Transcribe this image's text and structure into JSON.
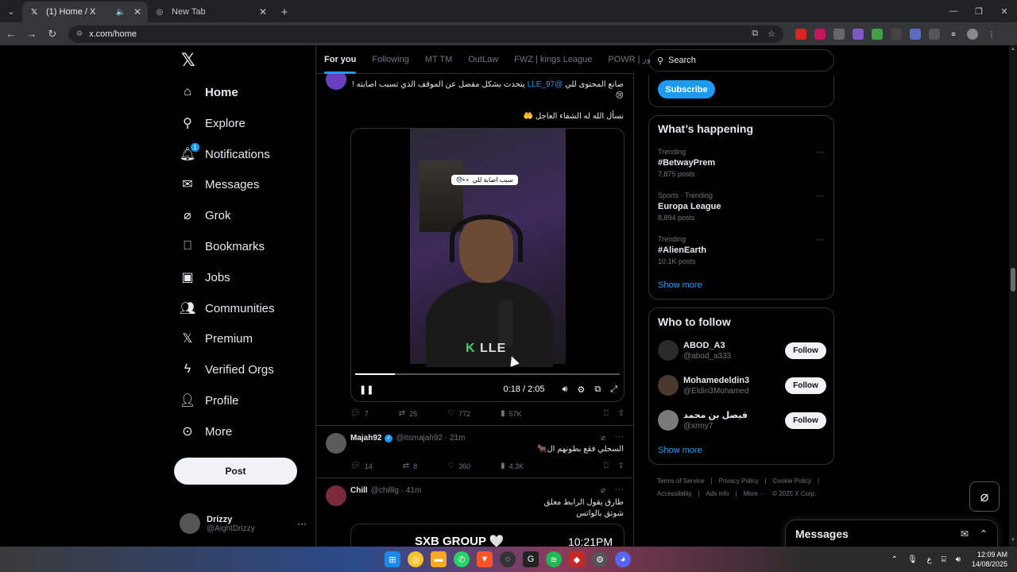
{
  "browser": {
    "tabs": [
      {
        "title": "(1) Home / X",
        "active": true
      },
      {
        "title": "New Tab",
        "active": false
      }
    ],
    "url": "x.com/home"
  },
  "nav": {
    "items": [
      {
        "label": "Home",
        "icon": "home-icon"
      },
      {
        "label": "Explore",
        "icon": "search-icon"
      },
      {
        "label": "Notifications",
        "icon": "bell-icon",
        "badge": "1"
      },
      {
        "label": "Messages",
        "icon": "envelope-icon"
      },
      {
        "label": "Grok",
        "icon": "grok-icon"
      },
      {
        "label": "Bookmarks",
        "icon": "bookmark-icon"
      },
      {
        "label": "Jobs",
        "icon": "briefcase-icon"
      },
      {
        "label": "Communities",
        "icon": "people-icon"
      },
      {
        "label": "Premium",
        "icon": "x-icon"
      },
      {
        "label": "Verified Orgs",
        "icon": "lightning-icon"
      },
      {
        "label": "Profile",
        "icon": "person-icon"
      },
      {
        "label": "More",
        "icon": "more-circle-icon"
      }
    ],
    "post_label": "Post",
    "account": {
      "name": "Drizzy",
      "handle": "@AightDrizzy"
    }
  },
  "feed": {
    "tabs": [
      "For you",
      "Following",
      "MT TM",
      "OutLaw",
      "FWZ | kings League",
      "POWR | ور"
    ],
    "tweet1": {
      "line1_pre": "صانع المحتوى للي",
      "mention": "@LLE_97",
      "line1_post": "يتحدث بشكل مفصل عن الموقف الذي تسبب اصابته !",
      "line2": "😢",
      "line3": "نسأل الله له الشفاء العاجل 🤲",
      "video": {
        "caption": "سبب اصابة للي 👀😞",
        "logo_k": "K",
        "logo_text": "LLE",
        "time": "0:18 / 2:05",
        "progress": 0.15
      },
      "stats": {
        "replies": "7",
        "reposts": "25",
        "likes": "772",
        "views": "57K"
      }
    },
    "tweet2": {
      "name": "Majah92",
      "handle": "@itsmajah92 · 21m",
      "text": "السحلي فقع بطونهم ال🐂",
      "stats": {
        "replies": "14",
        "reposts": "8",
        "likes": "360",
        "views": "4.3K"
      }
    },
    "tweet3": {
      "name": "Chill",
      "handle": "@chilllg · 41m",
      "text1": "طارق يقول الرابط معلق",
      "text2": "شوتق بالواتس",
      "card_title": "SXB GROUP 🤍",
      "card_time": "10:21PM"
    }
  },
  "right": {
    "search_placeholder": "Search",
    "subscribe_label": "Subscribe",
    "happening_title": "What’s happening",
    "trends": [
      {
        "context": "Trending",
        "name": "#BetwayPrem",
        "count": "7,875 posts"
      },
      {
        "context": "Sports · Trending",
        "name": "Europa League",
        "count": "8,894 posts"
      },
      {
        "context": "Trending",
        "name": "#AlienEarth",
        "count": "10.1K posts"
      }
    ],
    "show_more": "Show more",
    "who_title": "Who to follow",
    "follow_label": "Follow",
    "who": [
      {
        "name": "ABOD_A3",
        "handle": "@abod_a333"
      },
      {
        "name": "Mohamedeldin3",
        "handle": "@Eldin3Mohamed"
      },
      {
        "name": "فيصل بن محمد",
        "handle": "@xrmy7"
      }
    ],
    "footer": [
      "Terms of Service",
      "|",
      "Privacy Policy",
      "|",
      "Cookie Policy",
      "|",
      "Accessibility",
      "|",
      "Ads info",
      "|",
      "More ···",
      "© 2025 X Corp."
    ]
  },
  "messages_drawer": {
    "title": "Messages"
  },
  "taskbar": {
    "time": "12:09 AM",
    "date": "14/08/2025",
    "lang": "ع"
  }
}
